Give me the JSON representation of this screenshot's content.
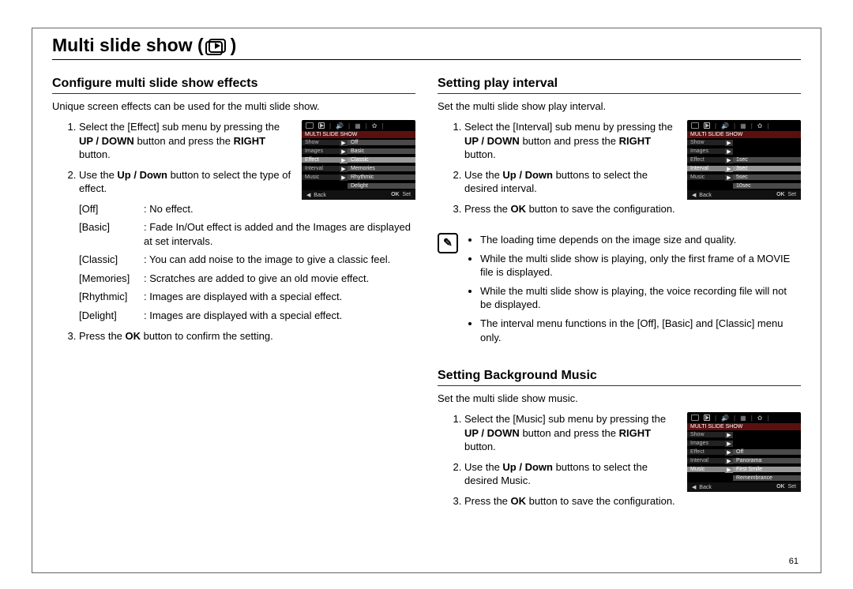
{
  "page": {
    "title": "Multi slide show (",
    "title_close": ")",
    "pagenum": "61"
  },
  "left": {
    "heading": "Configure multi slide show effects",
    "intro": "Unique screen effects can be used for the multi slide show.",
    "step1_a": "Select the [Effect] sub menu by pressing the ",
    "step1_b": "UP / DOWN",
    "step1_c": " button and press the ",
    "step1_d": "RIGHT",
    "step1_e": " button.",
    "step2_a": "Use the ",
    "step2_b": "Up / Down",
    "step2_c": " button to select the type of effect.",
    "defs": [
      {
        "key": "[Off]",
        "val": "No effect."
      },
      {
        "key": "[Basic]",
        "val": "Fade In/Out effect is added and the Images are displayed at set intervals."
      },
      {
        "key": "[Classic]",
        "val": "You can add noise to the image to give a classic feel."
      },
      {
        "key": "[Memories]",
        "val": "Scratches are added to give an old movie effect."
      },
      {
        "key": "[Rhythmic]",
        "val": "Images are displayed with a special effect."
      },
      {
        "key": "[Delight]",
        "val": "Images are displayed with a special effect."
      }
    ],
    "step3_a": "Press the ",
    "step3_b": "OK",
    "step3_c": " button to confirm the setting.",
    "lcd": {
      "header": "MULTI SLIDE SHOW",
      "rows": [
        {
          "l": "Show",
          "r": "Off"
        },
        {
          "l": "Images",
          "r": "Basic"
        },
        {
          "l": "Effect",
          "r": "Classic",
          "sel": true
        },
        {
          "l": "Interval",
          "r": "Memories"
        },
        {
          "l": "Music",
          "r": "Rhythmic"
        },
        {
          "l": "",
          "r": "Delight"
        }
      ],
      "back": "Back",
      "ok": "OK",
      "set": "Set"
    }
  },
  "right1": {
    "heading": "Setting play interval",
    "intro": "Set the multi slide show play interval.",
    "step1_a": "Select the [Interval] sub menu by pressing the ",
    "step1_b": "UP / DOWN",
    "step1_c": " button and press the ",
    "step1_d": "RIGHT",
    "step1_e": " button.",
    "step2_a": "Use the ",
    "step2_b": "Up / Down",
    "step2_c": " buttons to select the desired interval.",
    "step3_a": "Press the ",
    "step3_b": "OK",
    "step3_c": " button to save the configuration.",
    "lcd": {
      "header": "MULTI SLIDE SHOW",
      "rows": [
        {
          "l": "Show",
          "r": ""
        },
        {
          "l": "Images",
          "r": ""
        },
        {
          "l": "Effect",
          "r": "1sec"
        },
        {
          "l": "Interval",
          "r": "3sec",
          "sel": true
        },
        {
          "l": "Music",
          "r": "5sec"
        },
        {
          "l": "",
          "r": "10sec"
        }
      ],
      "back": "Back",
      "ok": "OK",
      "set": "Set"
    },
    "notes": [
      "The loading time depends on the image size and quality.",
      "While the multi slide show is playing, only the first frame of a MOVIE file is displayed.",
      "While the multi slide show is playing, the voice recording file will not be displayed.",
      "The interval menu functions in the [Off], [Basic] and [Classic] menu only."
    ]
  },
  "right2": {
    "heading": "Setting Background Music",
    "intro": "Set the multi slide show music.",
    "step1_a": "Select the [Music] sub menu by pressing the ",
    "step1_b": "UP / DOWN",
    "step1_c": " button and press the ",
    "step1_d": "RIGHT",
    "step1_e": " button.",
    "step2_a": "Use the ",
    "step2_b": "Up / Down",
    "step2_c": " buttons to select the desired Music.",
    "step3_a": "Press the ",
    "step3_b": "OK",
    "step3_c": " button to save the configuration.",
    "lcd": {
      "header": "MULTI SLIDE SHOW",
      "rows": [
        {
          "l": "Show",
          "r": ""
        },
        {
          "l": "Images",
          "r": ""
        },
        {
          "l": "Effect",
          "r": "Off"
        },
        {
          "l": "Interval",
          "r": "Panorama"
        },
        {
          "l": "Music",
          "r": "First Smile",
          "sel": true
        },
        {
          "l": "",
          "r": "Remembrance"
        }
      ],
      "back": "Back",
      "ok": "OK",
      "set": "Set"
    }
  }
}
